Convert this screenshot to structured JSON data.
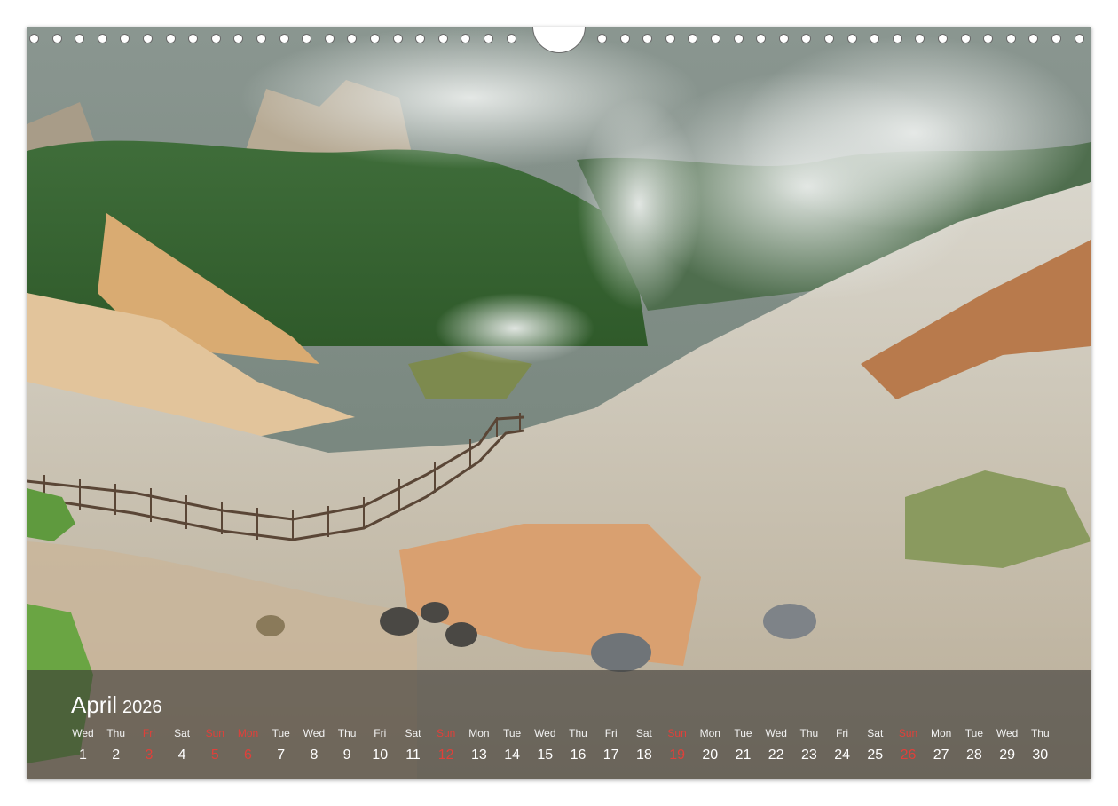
{
  "calendar": {
    "month": "April",
    "year": "2026",
    "days": [
      {
        "dow": "Wed",
        "day": "1",
        "red": false
      },
      {
        "dow": "Thu",
        "day": "2",
        "red": false
      },
      {
        "dow": "Fri",
        "day": "3",
        "red": true
      },
      {
        "dow": "Sat",
        "day": "4",
        "red": false
      },
      {
        "dow": "Sun",
        "day": "5",
        "red": true
      },
      {
        "dow": "Mon",
        "day": "6",
        "red": true
      },
      {
        "dow": "Tue",
        "day": "7",
        "red": false
      },
      {
        "dow": "Wed",
        "day": "8",
        "red": false
      },
      {
        "dow": "Thu",
        "day": "9",
        "red": false
      },
      {
        "dow": "Fri",
        "day": "10",
        "red": false
      },
      {
        "dow": "Sat",
        "day": "11",
        "red": false
      },
      {
        "dow": "Sun",
        "day": "12",
        "red": true
      },
      {
        "dow": "Mon",
        "day": "13",
        "red": false
      },
      {
        "dow": "Tue",
        "day": "14",
        "red": false
      },
      {
        "dow": "Wed",
        "day": "15",
        "red": false
      },
      {
        "dow": "Thu",
        "day": "16",
        "red": false
      },
      {
        "dow": "Fri",
        "day": "17",
        "red": false
      },
      {
        "dow": "Sat",
        "day": "18",
        "red": false
      },
      {
        "dow": "Sun",
        "day": "19",
        "red": true
      },
      {
        "dow": "Mon",
        "day": "20",
        "red": false
      },
      {
        "dow": "Tue",
        "day": "21",
        "red": false
      },
      {
        "dow": "Wed",
        "day": "22",
        "red": false
      },
      {
        "dow": "Thu",
        "day": "23",
        "red": false
      },
      {
        "dow": "Fri",
        "day": "24",
        "red": false
      },
      {
        "dow": "Sat",
        "day": "25",
        "red": false
      },
      {
        "dow": "Sun",
        "day": "26",
        "red": true
      },
      {
        "dow": "Mon",
        "day": "27",
        "red": false
      },
      {
        "dow": "Tue",
        "day": "28",
        "red": false
      },
      {
        "dow": "Wed",
        "day": "29",
        "red": false
      },
      {
        "dow": "Thu",
        "day": "30",
        "red": false
      }
    ]
  },
  "colors": {
    "holiday": "#e0403a",
    "band": "#3a3836",
    "text": "#ffffff"
  },
  "photo": {
    "subject": "volcanic-hell-valley-with-wooden-boardwalk-and-steam"
  }
}
